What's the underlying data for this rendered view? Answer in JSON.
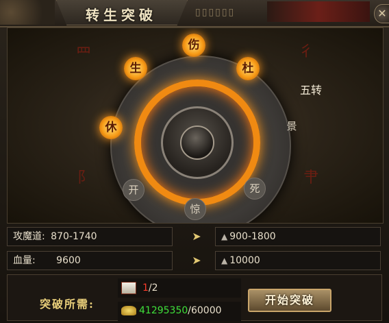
{
  "window": {
    "title": "转生突破",
    "close_glyph": "✕"
  },
  "wheel": {
    "gates": {
      "shang": "伤",
      "du": "杜",
      "sheng": "生",
      "xiu": "休",
      "kai": "开",
      "jing_alarm": "惊",
      "si": "死",
      "jing_view": "景"
    },
    "status_label": "五转"
  },
  "stats": {
    "attack_label": "攻魔道:",
    "attack_current": "870-1740",
    "attack_next": "900-1800",
    "hp_label": "血量:",
    "hp_current": "9600",
    "hp_next": "10000"
  },
  "requirements": {
    "label": "突破所需:",
    "item_owned": "1",
    "item_sep_total": "/2",
    "gold_owned": "41295350",
    "gold_sep_total": "/60000"
  },
  "actions": {
    "start_label": "开始突破"
  },
  "colors": {
    "accent_orange": "#f08a12",
    "insufficient_red": "#ff3b2a",
    "sufficient_green": "#3fe03a"
  }
}
